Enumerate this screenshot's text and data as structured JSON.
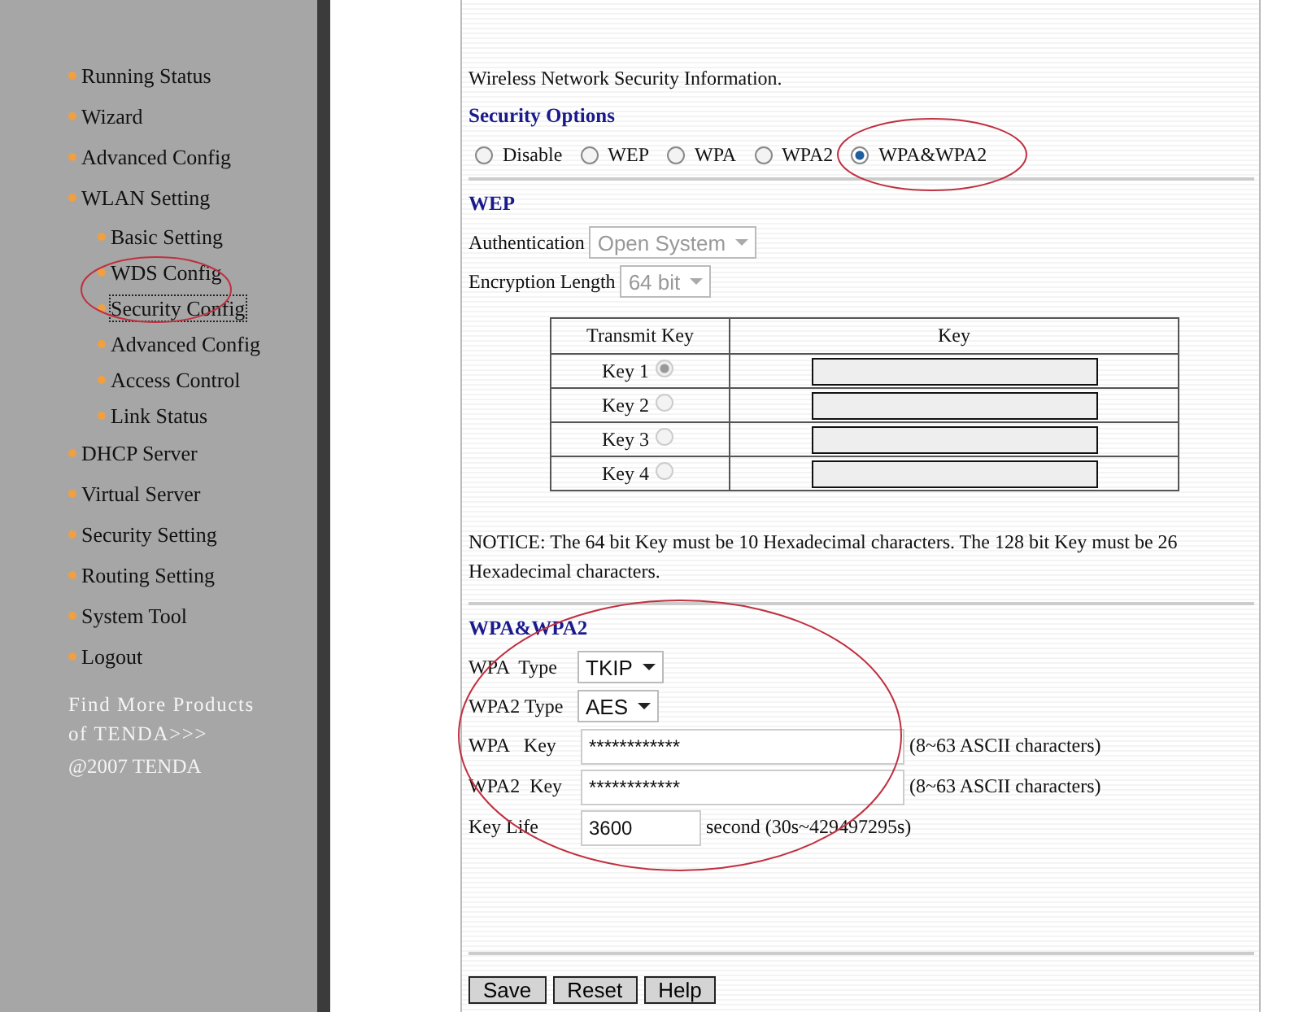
{
  "sidebar": {
    "items": [
      {
        "label": "Running Status",
        "selected": false
      },
      {
        "label": "Wizard",
        "selected": false
      },
      {
        "label": "Advanced Config",
        "selected": false
      },
      {
        "label": "WLAN Setting",
        "selected": false,
        "children": [
          {
            "label": "Basic Setting",
            "selected": false
          },
          {
            "label": "WDS Config",
            "selected": false
          },
          {
            "label": "Security Config",
            "selected": true
          },
          {
            "label": "Advanced Config",
            "selected": false
          },
          {
            "label": "Access Control",
            "selected": false
          },
          {
            "label": "Link Status",
            "selected": false
          }
        ]
      },
      {
        "label": "DHCP Server",
        "selected": false
      },
      {
        "label": "Virtual Server",
        "selected": false
      },
      {
        "label": "Security Setting",
        "selected": false
      },
      {
        "label": "Routing Setting",
        "selected": false
      },
      {
        "label": "System Tool",
        "selected": false
      },
      {
        "label": "Logout",
        "selected": false
      }
    ],
    "more_link": "Find More Products of TENDA>>>",
    "copyright": "@2007 TENDA"
  },
  "intro": "Wireless Network Security Information.",
  "security_options": {
    "title": "Security Options",
    "options": [
      {
        "label": "Disable",
        "selected": false
      },
      {
        "label": "WEP",
        "selected": false
      },
      {
        "label": "WPA",
        "selected": false
      },
      {
        "label": "WPA2",
        "selected": false
      },
      {
        "label": "WPA&WPA2",
        "selected": true
      }
    ]
  },
  "wep": {
    "title": "WEP",
    "disabled": true,
    "authentication": {
      "label": "Authentication",
      "value": "Open System"
    },
    "encryption_length": {
      "label": "Encryption Length",
      "value": "64 bit"
    },
    "table": {
      "columns": [
        "Transmit Key",
        "Key"
      ],
      "rows": [
        {
          "label": "Key 1",
          "selected": true
        },
        {
          "label": "Key 2",
          "selected": false
        },
        {
          "label": "Key 3",
          "selected": false
        },
        {
          "label": "Key 4",
          "selected": false
        }
      ]
    },
    "notice": "NOTICE: The 64 bit Key must be 10 Hexadecimal characters. The 128 bit Key must be 26 Hexadecimal characters."
  },
  "wpa": {
    "title": "WPA&WPA2",
    "fields": [
      {
        "kind": "select",
        "label": "WPA  Type",
        "value": "TKIP"
      },
      {
        "kind": "select",
        "label": "WPA2 Type",
        "value": "AES"
      },
      {
        "kind": "text",
        "label": "WPA   Key",
        "value": "************",
        "hint": "(8~63 ASCII characters)"
      },
      {
        "kind": "text",
        "label": "WPA2  Key",
        "value": "************",
        "hint": "(8~63 ASCII characters)"
      },
      {
        "kind": "short",
        "label": "Key Life",
        "value": "3600",
        "hint": "second (30s~429497295s)"
      }
    ]
  },
  "buttons": [
    "Save",
    "Reset",
    "Help"
  ]
}
